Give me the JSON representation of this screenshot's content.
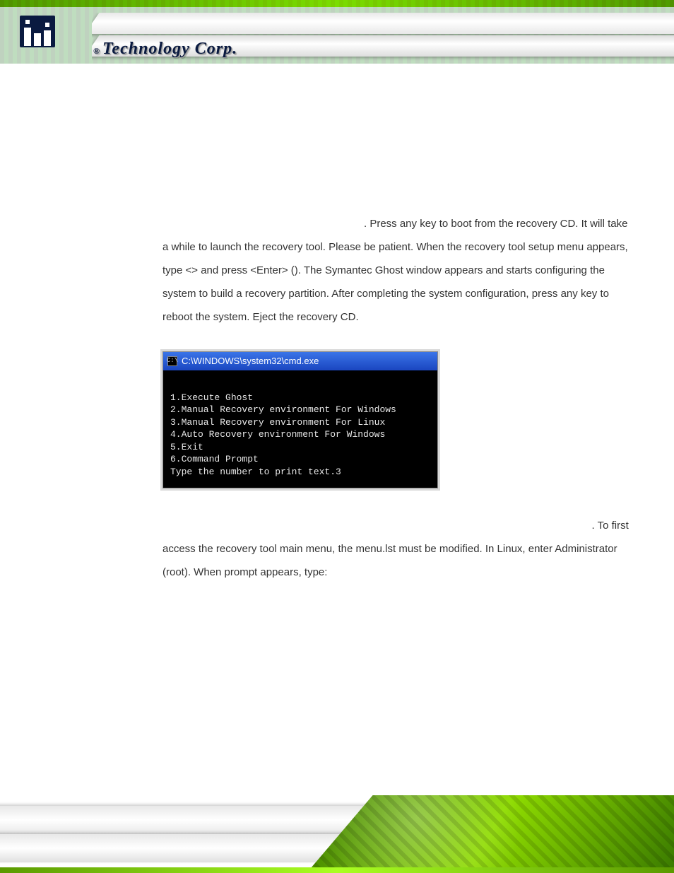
{
  "header": {
    "brand_reg": "®",
    "brand_text": "Technology Corp."
  },
  "body": {
    "para1_a": ". Press any key to boot from the recovery CD. It will take a while to launch the recovery tool. Please be patient. When the recovery tool setup menu appears, type <",
    "para1_key": "",
    "para1_b": "> and press <Enter> (",
    "para1_ref": "",
    "para1_c": "). The Symantec Ghost window appears and starts configuring the system to build a recovery partition. After completing the system configuration, press any key to reboot the system. Eject the recovery CD.",
    "para2_a": ". To first access the recovery tool main menu, the menu.lst must be modified. In Linux, enter Administrator (root). When prompt appears, type:"
  },
  "cmd": {
    "title": "C:\\WINDOWS\\system32\\cmd.exe",
    "icon_glyph": "C:\\",
    "lines": [
      "",
      "1.Execute Ghost",
      "2.Manual Recovery environment For Windows",
      "3.Manual Recovery environment For Linux",
      "4.Auto Recovery environment For Windows",
      "5.Exit",
      "6.Command Prompt",
      "Type the number to print text.3"
    ]
  }
}
